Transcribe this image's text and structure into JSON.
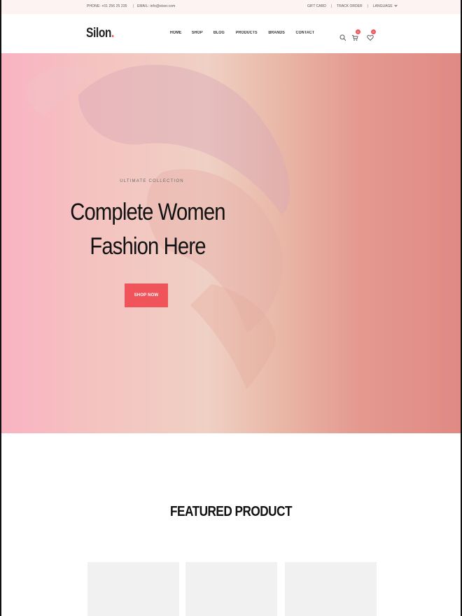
{
  "topbar": {
    "phone": "PHONE: +01 256 25 235",
    "email": "EMAIL: info@eiser.com",
    "gift_card": "GIFT CARD",
    "track_order": "TRACK ORDER",
    "language": "LANGUAGE"
  },
  "header": {
    "logo_text": "Silon",
    "logo_dot": ".",
    "nav": [
      "HOME",
      "SHOP",
      "BLOG",
      "PRODUCTS",
      "BRANDS",
      "CONTACT"
    ],
    "cart_count": "0",
    "wishlist_count": "0"
  },
  "hero": {
    "kicker": "ULTIMATE COLLECTION",
    "title_line1": "Complete Women",
    "title_line2": "Fashion Here",
    "button_label": "SHOP NOW"
  },
  "featured": {
    "title": "FEATURED PRODUCT",
    "product_count": 3
  },
  "colors": {
    "accent": "#f0545a",
    "topbar_bg": "#fdf3f3",
    "product_placeholder": "#f1f1f1"
  },
  "icons": [
    "search-icon",
    "cart-icon",
    "heart-icon",
    "chevron-down-icon"
  ]
}
